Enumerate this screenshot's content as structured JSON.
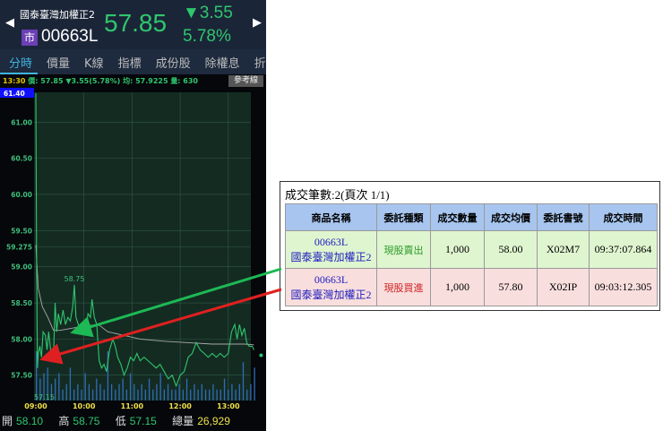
{
  "header": {
    "name": "國泰臺灣加權正2",
    "market_badge": "市",
    "code": "00663L",
    "price": "57.85",
    "change": "▼3.55",
    "change_pct": "5.78%",
    "prev_icon": "left-arrow-icon",
    "next_icon": "right-arrow-icon"
  },
  "tabs": [
    "分時",
    "價量",
    "K線",
    "指標",
    "成份股",
    "除權息",
    "折"
  ],
  "info": {
    "time": "13:30",
    "price": "價: 57.85 ▼3.55(5.78%)",
    "avg": "均: 57.9225",
    "vol": "量: 630",
    "ref_button": "參考線"
  },
  "chart": {
    "y_labels": [
      "61.40",
      "61.00",
      "60.50",
      "60.00",
      "59.50",
      "59.275",
      "59.00",
      "58.50",
      "58.00",
      "57.50"
    ],
    "y_values": [
      61.4,
      61.0,
      60.5,
      60.0,
      59.5,
      59.275,
      59.0,
      58.5,
      58.0,
      57.5
    ],
    "x_labels": [
      "09:00",
      "10:00",
      "11:00",
      "12:00",
      "13:00"
    ],
    "high_label": "58.75",
    "low_label": "57.15",
    "price": [
      [
        0,
        61.4
      ],
      [
        1,
        59.0
      ],
      [
        2,
        57.6
      ],
      [
        3,
        57.8
      ],
      [
        5,
        57.9
      ],
      [
        7,
        57.75
      ],
      [
        9,
        58.1
      ],
      [
        12,
        58.05
      ],
      [
        14,
        57.85
      ],
      [
        16,
        58.1
      ],
      [
        18,
        57.9
      ],
      [
        20,
        57.7
      ],
      [
        22,
        57.75
      ],
      [
        24,
        58.5
      ],
      [
        26,
        58.1
      ],
      [
        28,
        58.35
      ],
      [
        31,
        58.2
      ],
      [
        34,
        58.4
      ],
      [
        37,
        58.2
      ],
      [
        40,
        58.3
      ],
      [
        43,
        58.25
      ],
      [
        46,
        58.45
      ],
      [
        48,
        58.75
      ],
      [
        50,
        58.3
      ],
      [
        53,
        58.2
      ],
      [
        56,
        58.1
      ],
      [
        59,
        58.2
      ],
      [
        62,
        58.1
      ],
      [
        65,
        58.35
      ],
      [
        68,
        58.3
      ],
      [
        70,
        58.55
      ],
      [
        73,
        58.3
      ],
      [
        76,
        58.2
      ],
      [
        79,
        57.7
      ],
      [
        82,
        57.6
      ],
      [
        85,
        57.65
      ],
      [
        88,
        57.55
      ],
      [
        92,
        57.85
      ],
      [
        96,
        58.0
      ],
      [
        99,
        57.9
      ],
      [
        102,
        57.75
      ],
      [
        106,
        57.65
      ],
      [
        110,
        57.5
      ],
      [
        114,
        57.6
      ],
      [
        118,
        57.75
      ],
      [
        122,
        57.7
      ],
      [
        126,
        57.8
      ],
      [
        130,
        57.7
      ],
      [
        135,
        57.75
      ],
      [
        140,
        57.7
      ],
      [
        145,
        57.65
      ],
      [
        150,
        57.6
      ],
      [
        155,
        57.65
      ],
      [
        160,
        57.55
      ],
      [
        165,
        57.45
      ],
      [
        170,
        57.5
      ],
      [
        175,
        57.35
      ],
      [
        180,
        57.5
      ],
      [
        185,
        57.55
      ],
      [
        190,
        57.75
      ],
      [
        195,
        57.8
      ],
      [
        200,
        57.95
      ],
      [
        205,
        57.85
      ],
      [
        210,
        57.8
      ],
      [
        215,
        57.75
      ],
      [
        220,
        57.8
      ],
      [
        225,
        57.75
      ],
      [
        230,
        57.8
      ],
      [
        235,
        57.75
      ],
      [
        240,
        57.8
      ],
      [
        244,
        58.1
      ],
      [
        248,
        58.2
      ],
      [
        251,
        58.0
      ],
      [
        254,
        58.2
      ],
      [
        257,
        58.05
      ],
      [
        260,
        58.15
      ],
      [
        263,
        57.95
      ],
      [
        266,
        57.9
      ],
      [
        270,
        57.9
      ],
      [
        272,
        57.85
      ]
    ],
    "avg": [
      [
        0,
        59.3
      ],
      [
        3,
        58.7
      ],
      [
        8,
        58.45
      ],
      [
        15,
        58.3
      ],
      [
        22,
        58.12
      ],
      [
        30,
        58.12
      ],
      [
        45,
        58.15
      ],
      [
        60,
        58.18
      ],
      [
        78,
        58.2
      ],
      [
        90,
        58.1
      ],
      [
        110,
        58.05
      ],
      [
        130,
        58.0
      ],
      [
        160,
        57.97
      ],
      [
        190,
        57.95
      ],
      [
        220,
        57.93
      ],
      [
        260,
        57.93
      ],
      [
        272,
        57.92
      ]
    ],
    "volume": [
      9,
      4,
      5,
      6,
      3,
      4,
      5,
      2,
      3,
      6,
      2,
      3,
      2,
      5,
      3,
      2,
      4,
      3,
      2,
      9,
      3,
      2,
      3,
      4,
      2,
      5,
      3,
      2,
      3,
      2,
      4,
      2,
      3,
      5,
      2,
      3,
      2,
      2,
      3,
      2,
      4,
      2,
      3,
      2,
      3,
      2,
      2,
      3,
      2,
      2,
      4,
      2,
      3,
      2,
      3,
      7,
      2,
      3,
      6
    ]
  },
  "summary": {
    "open_label": "開",
    "open": "58.10",
    "high_label": "高",
    "high": "58.75",
    "low_label": "低",
    "low": "57.15",
    "vol_label": "總量",
    "vol": "26,929"
  },
  "trades": {
    "title": "成交筆數:2(頁次 1/1)",
    "headers": [
      "商品名稱",
      "委託種類",
      "成交數量",
      "成交均價",
      "委託書號",
      "成交時間"
    ],
    "rows": [
      {
        "code": "00663L",
        "name": "國泰臺灣加權正2",
        "type": "現股賣出",
        "qty": "1,000",
        "price": "58.00",
        "order": "X02M7",
        "time": "09:37:07.864"
      },
      {
        "code": "00663L",
        "name": "國泰臺灣加權正2",
        "type": "現股買進",
        "qty": "1,000",
        "price": "57.80",
        "order": "X02IP",
        "time": "09:03:12.305"
      }
    ]
  },
  "colors": {
    "up": "#2fc66d",
    "sell_arrow": "#1db954",
    "buy_arrow": "#e02020"
  }
}
